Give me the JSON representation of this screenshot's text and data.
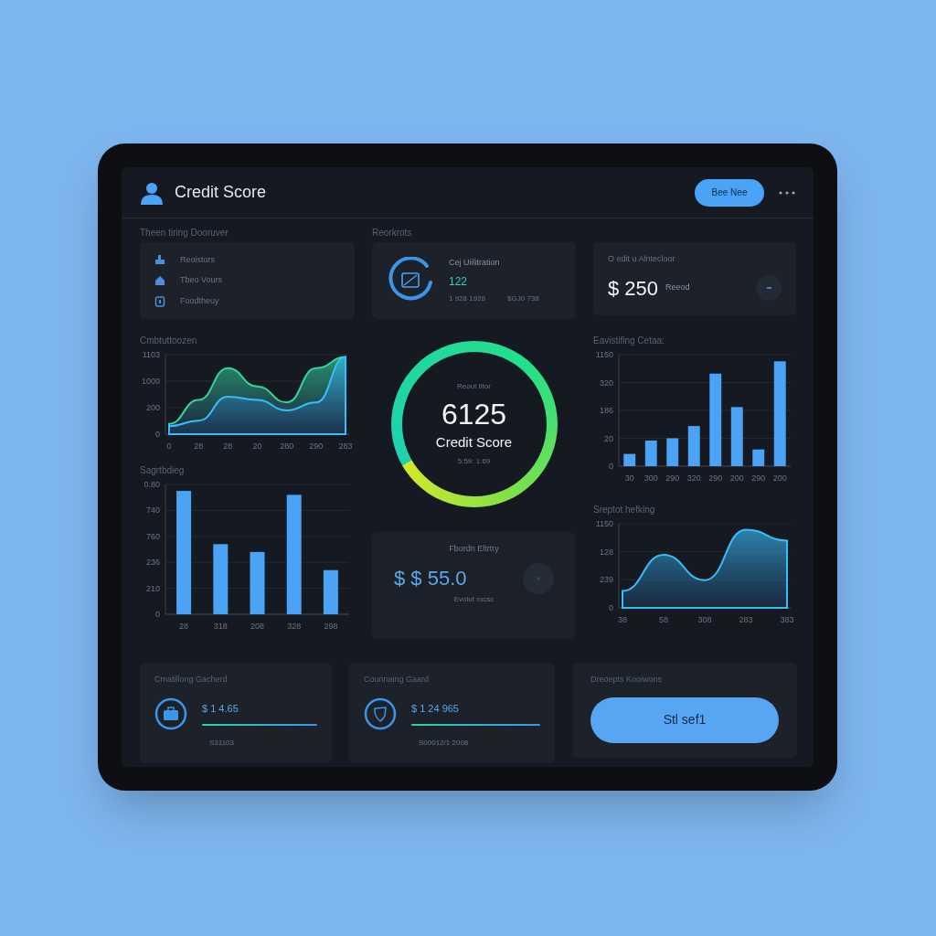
{
  "header": {
    "title": "Credit Score",
    "button": "Bee Nee"
  },
  "overview": {
    "label": "Theen tiring Dooruver",
    "items": [
      "Reoistors",
      "Tbeo Vours",
      "Foodtheuy"
    ]
  },
  "utilization": {
    "label": "Reorkrots",
    "title": "Cej Uiilitration",
    "value": "122",
    "note_1": "1 928 1928",
    "note_2": "$GJ0 738"
  },
  "credit_card": {
    "title": "O edit u Alntecloor",
    "amount": "$ 250",
    "unit": "Reeod"
  },
  "history_chart": {
    "title": "Cmbtuttoozen",
    "kind": "area",
    "y_labels": [
      "1103",
      "1000",
      "200",
      "0"
    ],
    "x_labels": [
      "0",
      "28",
      "28",
      "20",
      "280",
      "290",
      "283"
    ]
  },
  "spending_chart": {
    "title": "Sagrtbdieg",
    "kind": "bar",
    "y_labels": [
      "0.80",
      "740",
      "760",
      "236",
      "210",
      "0"
    ],
    "x_labels": [
      "28",
      "318",
      "208",
      "328",
      "298"
    ]
  },
  "gauge": {
    "label": "Reout Iitor",
    "score": "6125",
    "caption": "Credit Score",
    "note": "5:59: 1:69"
  },
  "balance_card": {
    "title": "Fbordn Eltrtry",
    "amount": "$ $ 55.0",
    "note": "Evolut rocsc"
  },
  "activity_chart": {
    "title": "Eavistifing Cetaa:",
    "kind": "bar",
    "y_labels": [
      "1150",
      "320",
      "186",
      "20",
      "0"
    ],
    "x_labels": [
      "30",
      "300",
      "290",
      "320",
      "290",
      "200",
      "290",
      "200"
    ]
  },
  "trend_chart": {
    "title": "Sreptot hefking",
    "kind": "area",
    "y_labels": [
      "1150",
      "128",
      "239",
      "0"
    ],
    "x_labels": [
      "38",
      "58",
      "308",
      "283",
      "383"
    ]
  },
  "bottom_cards": [
    {
      "kind": "briefcase",
      "title": "Cmatillong Gacherd",
      "amount": "$ 1 4.65",
      "note": "S31103"
    },
    {
      "kind": "shield",
      "title": "Counnaing Gaard",
      "amount": "$ 1 24 965",
      "note": "S00012/1 2008"
    }
  ],
  "action_card": {
    "title": "Dreoepts Kooiwons",
    "button": "Stl sef1"
  }
}
